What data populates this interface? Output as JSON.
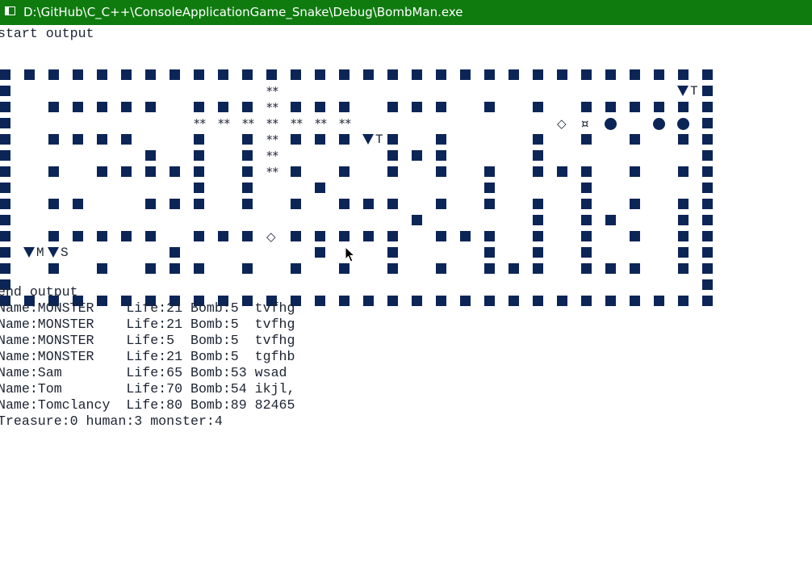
{
  "window": {
    "title": "D:\\GitHub\\C_C++\\ConsoleApplicationGame_Snake\\Debug\\BombMan.exe"
  },
  "console": {
    "start_line": "start output",
    "end_line": "end output",
    "board_rows": [
      "#############################",
      "#          **              VT#",
      "# ##### ### ** ### ### # ####",
      "#       ** ** ** ** ** ** **  <> @ o  o o#",
      "# #### # # ** ### VT# # # # #",
      "#     # # # **    # # #  # #",
      "# # ### # # ** # # #  # # # # # #",
      "#       # #    #       #  #  #",
      "# ## ### # # ###  # #   # #  #",
      "#                #  # # #   #",
      "# ##### ### <> ## ### # # # #",
      "#VMVS  #        #   #  # #  #",
      "# ## ## # # # #  # ## ### # #",
      "#                            #",
      "#############################"
    ],
    "board_cells": [
      [
        0,
        0,
        "wall"
      ],
      [
        1,
        0,
        "wall"
      ],
      [
        2,
        0,
        "wall"
      ],
      [
        3,
        0,
        "wall"
      ],
      [
        4,
        0,
        "wall"
      ],
      [
        5,
        0,
        "wall"
      ],
      [
        6,
        0,
        "wall"
      ],
      [
        7,
        0,
        "wall"
      ],
      [
        8,
        0,
        "wall"
      ],
      [
        9,
        0,
        "wall"
      ],
      [
        10,
        0,
        "wall"
      ],
      [
        11,
        0,
        "wall"
      ],
      [
        12,
        0,
        "wall"
      ],
      [
        13,
        0,
        "wall"
      ],
      [
        14,
        0,
        "wall"
      ],
      [
        15,
        0,
        "wall"
      ],
      [
        16,
        0,
        "wall"
      ],
      [
        17,
        0,
        "wall"
      ],
      [
        18,
        0,
        "wall"
      ],
      [
        19,
        0,
        "wall"
      ],
      [
        20,
        0,
        "wall"
      ],
      [
        21,
        0,
        "wall"
      ],
      [
        22,
        0,
        "wall"
      ],
      [
        23,
        0,
        "wall"
      ],
      [
        24,
        0,
        "wall"
      ],
      [
        25,
        0,
        "wall"
      ],
      [
        26,
        0,
        "wall"
      ],
      [
        27,
        0,
        "wall"
      ],
      [
        28,
        0,
        "wall"
      ],
      [
        29,
        0,
        "wall"
      ],
      [
        0,
        1,
        "wall"
      ],
      [
        11,
        1,
        "box"
      ],
      [
        28,
        1,
        "tri",
        "T"
      ],
      [
        29,
        1,
        "wall"
      ],
      [
        0,
        2,
        "wall"
      ],
      [
        2,
        2,
        "wall"
      ],
      [
        3,
        2,
        "wall"
      ],
      [
        4,
        2,
        "wall"
      ],
      [
        5,
        2,
        "wall"
      ],
      [
        6,
        2,
        "wall"
      ],
      [
        8,
        2,
        "wall"
      ],
      [
        9,
        2,
        "wall"
      ],
      [
        10,
        2,
        "wall"
      ],
      [
        11,
        2,
        "box"
      ],
      [
        12,
        2,
        "wall"
      ],
      [
        13,
        2,
        "wall"
      ],
      [
        14,
        2,
        "wall"
      ],
      [
        16,
        2,
        "wall"
      ],
      [
        17,
        2,
        "wall"
      ],
      [
        18,
        2,
        "wall"
      ],
      [
        20,
        2,
        "wall"
      ],
      [
        22,
        2,
        "wall"
      ],
      [
        24,
        2,
        "wall"
      ],
      [
        25,
        2,
        "wall"
      ],
      [
        26,
        2,
        "wall"
      ],
      [
        27,
        2,
        "wall"
      ],
      [
        28,
        2,
        "wall"
      ],
      [
        29,
        2,
        "wall"
      ],
      [
        0,
        3,
        "wall"
      ],
      [
        8,
        3,
        "box"
      ],
      [
        9,
        3,
        "box"
      ],
      [
        10,
        3,
        "box"
      ],
      [
        11,
        3,
        "box"
      ],
      [
        12,
        3,
        "box"
      ],
      [
        13,
        3,
        "box"
      ],
      [
        14,
        3,
        "box"
      ],
      [
        23,
        3,
        "diamond"
      ],
      [
        24,
        3,
        "treasure"
      ],
      [
        25,
        3,
        "bomb"
      ],
      [
        27,
        3,
        "bomb"
      ],
      [
        28,
        3,
        "bomb"
      ],
      [
        29,
        3,
        "wall"
      ],
      [
        0,
        4,
        "wall"
      ],
      [
        2,
        4,
        "wall"
      ],
      [
        3,
        4,
        "wall"
      ],
      [
        4,
        4,
        "wall"
      ],
      [
        5,
        4,
        "wall"
      ],
      [
        8,
        4,
        "wall"
      ],
      [
        10,
        4,
        "wall"
      ],
      [
        11,
        4,
        "box"
      ],
      [
        12,
        4,
        "wall"
      ],
      [
        13,
        4,
        "wall"
      ],
      [
        14,
        4,
        "wall"
      ],
      [
        15,
        4,
        "tri",
        "T"
      ],
      [
        16,
        4,
        "wall"
      ],
      [
        18,
        4,
        "wall"
      ],
      [
        22,
        4,
        "wall"
      ],
      [
        24,
        4,
        "wall"
      ],
      [
        26,
        4,
        "wall"
      ],
      [
        28,
        4,
        "wall"
      ],
      [
        29,
        4,
        "wall"
      ],
      [
        0,
        5,
        "wall"
      ],
      [
        6,
        5,
        "wall"
      ],
      [
        8,
        5,
        "wall"
      ],
      [
        10,
        5,
        "wall"
      ],
      [
        11,
        5,
        "box"
      ],
      [
        16,
        5,
        "wall"
      ],
      [
        17,
        5,
        "wall"
      ],
      [
        18,
        5,
        "wall"
      ],
      [
        22,
        5,
        "wall"
      ],
      [
        29,
        5,
        "wall"
      ],
      [
        0,
        6,
        "wall"
      ],
      [
        2,
        6,
        "wall"
      ],
      [
        4,
        6,
        "wall"
      ],
      [
        5,
        6,
        "wall"
      ],
      [
        6,
        6,
        "wall"
      ],
      [
        7,
        6,
        "wall"
      ],
      [
        8,
        6,
        "wall"
      ],
      [
        10,
        6,
        "wall"
      ],
      [
        11,
        6,
        "box"
      ],
      [
        12,
        6,
        "wall"
      ],
      [
        14,
        6,
        "wall"
      ],
      [
        16,
        6,
        "wall"
      ],
      [
        18,
        6,
        "wall"
      ],
      [
        20,
        6,
        "wall"
      ],
      [
        22,
        6,
        "wall"
      ],
      [
        23,
        6,
        "wall"
      ],
      [
        24,
        6,
        "wall"
      ],
      [
        26,
        6,
        "wall"
      ],
      [
        28,
        6,
        "wall"
      ],
      [
        29,
        6,
        "wall"
      ],
      [
        0,
        7,
        "wall"
      ],
      [
        8,
        7,
        "wall"
      ],
      [
        10,
        7,
        "wall"
      ],
      [
        13,
        7,
        "wall"
      ],
      [
        20,
        7,
        "wall"
      ],
      [
        24,
        7,
        "wall"
      ],
      [
        29,
        7,
        "wall"
      ],
      [
        0,
        8,
        "wall"
      ],
      [
        2,
        8,
        "wall"
      ],
      [
        3,
        8,
        "wall"
      ],
      [
        6,
        8,
        "wall"
      ],
      [
        7,
        8,
        "wall"
      ],
      [
        8,
        8,
        "wall"
      ],
      [
        10,
        8,
        "wall"
      ],
      [
        12,
        8,
        "wall"
      ],
      [
        14,
        8,
        "wall"
      ],
      [
        15,
        8,
        "wall"
      ],
      [
        16,
        8,
        "wall"
      ],
      [
        18,
        8,
        "wall"
      ],
      [
        20,
        8,
        "wall"
      ],
      [
        22,
        8,
        "wall"
      ],
      [
        24,
        8,
        "wall"
      ],
      [
        26,
        8,
        "wall"
      ],
      [
        28,
        8,
        "wall"
      ],
      [
        29,
        8,
        "wall"
      ],
      [
        0,
        9,
        "wall"
      ],
      [
        17,
        9,
        "wall"
      ],
      [
        22,
        9,
        "wall"
      ],
      [
        24,
        9,
        "wall"
      ],
      [
        25,
        9,
        "wall"
      ],
      [
        28,
        9,
        "wall"
      ],
      [
        29,
        9,
        "wall"
      ],
      [
        0,
        10,
        "wall"
      ],
      [
        2,
        10,
        "wall"
      ],
      [
        3,
        10,
        "wall"
      ],
      [
        4,
        10,
        "wall"
      ],
      [
        5,
        10,
        "wall"
      ],
      [
        6,
        10,
        "wall"
      ],
      [
        8,
        10,
        "wall"
      ],
      [
        9,
        10,
        "wall"
      ],
      [
        10,
        10,
        "wall"
      ],
      [
        11,
        10,
        "diamond"
      ],
      [
        12,
        10,
        "wall"
      ],
      [
        13,
        10,
        "wall"
      ],
      [
        14,
        10,
        "wall"
      ],
      [
        15,
        10,
        "wall"
      ],
      [
        16,
        10,
        "wall"
      ],
      [
        18,
        10,
        "wall"
      ],
      [
        19,
        10,
        "wall"
      ],
      [
        20,
        10,
        "wall"
      ],
      [
        22,
        10,
        "wall"
      ],
      [
        24,
        10,
        "wall"
      ],
      [
        26,
        10,
        "wall"
      ],
      [
        28,
        10,
        "wall"
      ],
      [
        29,
        10,
        "wall"
      ],
      [
        0,
        11,
        "wall"
      ],
      [
        1,
        11,
        "tri",
        "M"
      ],
      [
        2,
        11,
        "tri",
        "S"
      ],
      [
        7,
        11,
        "wall"
      ],
      [
        13,
        11,
        "wall"
      ],
      [
        16,
        11,
        "wall"
      ],
      [
        20,
        11,
        "wall"
      ],
      [
        22,
        11,
        "wall"
      ],
      [
        24,
        11,
        "wall"
      ],
      [
        28,
        11,
        "wall"
      ],
      [
        29,
        11,
        "wall"
      ],
      [
        0,
        12,
        "wall"
      ],
      [
        2,
        12,
        "wall"
      ],
      [
        4,
        12,
        "wall"
      ],
      [
        6,
        12,
        "wall"
      ],
      [
        7,
        12,
        "wall"
      ],
      [
        8,
        12,
        "wall"
      ],
      [
        10,
        12,
        "wall"
      ],
      [
        12,
        12,
        "wall"
      ],
      [
        14,
        12,
        "wall"
      ],
      [
        16,
        12,
        "wall"
      ],
      [
        18,
        12,
        "wall"
      ],
      [
        20,
        12,
        "wall"
      ],
      [
        21,
        12,
        "wall"
      ],
      [
        22,
        12,
        "wall"
      ],
      [
        24,
        12,
        "wall"
      ],
      [
        25,
        12,
        "wall"
      ],
      [
        26,
        12,
        "wall"
      ],
      [
        28,
        12,
        "wall"
      ],
      [
        29,
        12,
        "wall"
      ],
      [
        0,
        13,
        "wall"
      ],
      [
        29,
        13,
        "wall"
      ],
      [
        0,
        14,
        "wall"
      ],
      [
        1,
        14,
        "wall"
      ],
      [
        2,
        14,
        "wall"
      ],
      [
        3,
        14,
        "wall"
      ],
      [
        4,
        14,
        "wall"
      ],
      [
        5,
        14,
        "wall"
      ],
      [
        6,
        14,
        "wall"
      ],
      [
        7,
        14,
        "wall"
      ],
      [
        8,
        14,
        "wall"
      ],
      [
        9,
        14,
        "wall"
      ],
      [
        10,
        14,
        "wall"
      ],
      [
        11,
        14,
        "wall"
      ],
      [
        12,
        14,
        "wall"
      ],
      [
        13,
        14,
        "wall"
      ],
      [
        14,
        14,
        "wall"
      ],
      [
        15,
        14,
        "wall"
      ],
      [
        16,
        14,
        "wall"
      ],
      [
        17,
        14,
        "wall"
      ],
      [
        18,
        14,
        "wall"
      ],
      [
        19,
        14,
        "wall"
      ],
      [
        20,
        14,
        "wall"
      ],
      [
        21,
        14,
        "wall"
      ],
      [
        22,
        14,
        "wall"
      ],
      [
        23,
        14,
        "wall"
      ],
      [
        24,
        14,
        "wall"
      ],
      [
        25,
        14,
        "wall"
      ],
      [
        26,
        14,
        "wall"
      ],
      [
        27,
        14,
        "wall"
      ],
      [
        28,
        14,
        "wall"
      ],
      [
        29,
        14,
        "wall"
      ]
    ],
    "cell_glyphs": {
      "box": "**",
      "diamond": "◇",
      "treasure": "¤"
    },
    "players": [
      {
        "name": "MONSTER",
        "life": "21",
        "bomb": "5",
        "keys": "tvfhg"
      },
      {
        "name": "MONSTER",
        "life": "21",
        "bomb": "5",
        "keys": "tvfhg"
      },
      {
        "name": "MONSTER",
        "life": "5",
        "bomb": "5",
        "keys": "tvfhg"
      },
      {
        "name": "MONSTER",
        "life": "21",
        "bomb": "5",
        "keys": "tgfhb"
      },
      {
        "name": "Sam",
        "life": "65",
        "bomb": "53",
        "keys": "wsad"
      },
      {
        "name": "Tom",
        "life": "70",
        "bomb": "54",
        "keys": "ikjl,"
      },
      {
        "name": "Tomclancy",
        "life": "80",
        "bomb": "89",
        "keys": "82465"
      }
    ],
    "summary": "Treasure:0 human:3 monster:4"
  },
  "colors": {
    "titlebar": "#0f7b0f",
    "console_bg": "#ffffff",
    "text": "#1c2433",
    "wall": "#0b2557"
  },
  "icons": {
    "window": "console-window-icon",
    "cursor": "mouse-pointer-icon"
  }
}
